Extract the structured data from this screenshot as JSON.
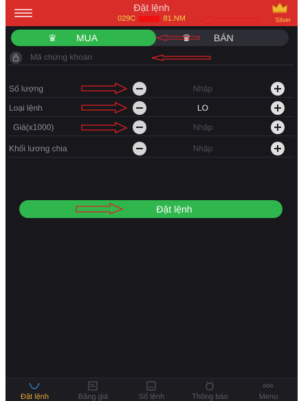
{
  "header": {
    "title": "Đặt lệnh",
    "account_prefix": "029C",
    "account_suffix": "81.NM",
    "tier_label": "Silver"
  },
  "side_toggle": {
    "buy_label": "MUA",
    "sell_label": "BÁN",
    "selected": "MUA"
  },
  "symbol": {
    "placeholder": "Mã chứng khoán"
  },
  "form": {
    "rows": [
      {
        "label": "Số lượng",
        "value": "Nhập"
      },
      {
        "label": "Loại lệnh",
        "value": "LO"
      },
      {
        "label": "Giá(x1000)",
        "value": "Nhập"
      },
      {
        "label": "Khối lương chia",
        "value": "Nhập"
      }
    ]
  },
  "submit_label": "Đặt lệnh",
  "bottom_nav": [
    {
      "label": "Đặt lệnh",
      "icon": "order-icon",
      "active": true
    },
    {
      "label": "Bảng giá",
      "icon": "price-board-icon",
      "active": false
    },
    {
      "label": "Sổ lệnh",
      "icon": "order-book-icon",
      "active": false
    },
    {
      "label": "Thông báo",
      "icon": "alarm-clock-icon",
      "active": false
    },
    {
      "label": "Menu",
      "icon": "menu-dots-icon",
      "active": false
    }
  ],
  "colors": {
    "header_red": "#d92d2a",
    "buy_green": "#2fb64c",
    "background": "#17171c",
    "annotation_red": "#e02020",
    "nav_active": "#e3a93a"
  }
}
